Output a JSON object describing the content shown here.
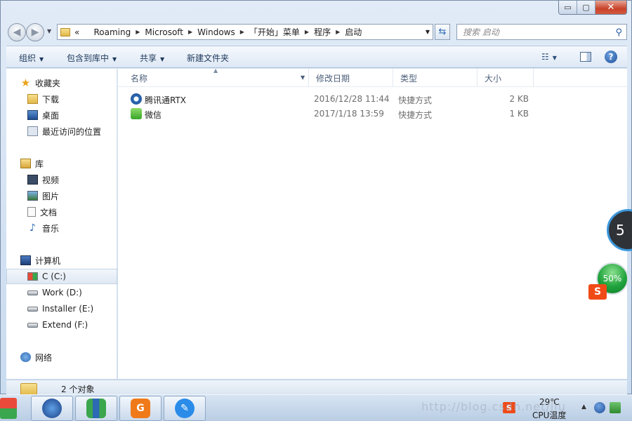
{
  "window": {
    "controls": {
      "minimize": "▭",
      "maximize": "▢",
      "close": "✕"
    }
  },
  "address": {
    "overflow": "«",
    "crumbs": [
      "Roaming",
      "Microsoft",
      "Windows",
      "「开始」菜单",
      "程序",
      "启动"
    ],
    "separator": "▶"
  },
  "search": {
    "placeholder": "搜索 启动"
  },
  "toolbar": {
    "organize": "组织",
    "include_library": "包含到库中",
    "share": "共享",
    "new_folder": "新建文件夹"
  },
  "nav": {
    "favorites": "收藏夹",
    "downloads": "下载",
    "desktop": "桌面",
    "recent": "最近访问的位置",
    "libraries": "库",
    "videos": "视频",
    "pictures": "图片",
    "documents": "文档",
    "music": "音乐",
    "computer": "计算机",
    "drive_c": "C (C:)",
    "drive_d": "Work (D:)",
    "drive_e": "Installer (E:)",
    "drive_f": "Extend (F:)",
    "network": "网络"
  },
  "columns": {
    "name": "名称",
    "date": "修改日期",
    "type": "类型",
    "size": "大小"
  },
  "files": [
    {
      "name": "腾讯通RTX",
      "date": "2016/12/28 11:44",
      "type": "快捷方式",
      "size": "2 KB"
    },
    {
      "name": "微信",
      "date": "2017/1/18 13:59",
      "type": "快捷方式",
      "size": "1 KB"
    }
  ],
  "status": {
    "count": "2 个对象"
  },
  "widgets": {
    "ring_value": "5",
    "ball_value": "50%"
  },
  "tray": {
    "temp": "29℃",
    "cpu_label": "CPU温度",
    "sogou": "S"
  },
  "watermark": "http://blog.csdn.net/liu",
  "colors": {
    "accent": "#2d6ab4",
    "close": "#c7432a",
    "selection": "#dfe8f3"
  }
}
